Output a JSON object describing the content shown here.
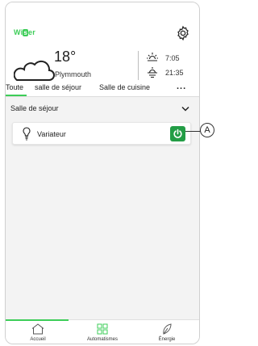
{
  "app": {
    "logo_text": "Wiser",
    "logo_part_a": "Wi",
    "logo_part_b": "s",
    "logo_part_c": "er"
  },
  "weather": {
    "temperature": "18°",
    "city": "Plymmouth",
    "sunrise": "7:05",
    "sunset": "21:35"
  },
  "tabs": [
    {
      "label": "Toute",
      "active": true
    },
    {
      "label": "salle de séjour",
      "active": false
    },
    {
      "label": "Salle de cuisine",
      "active": false
    }
  ],
  "more_label": "...",
  "section": {
    "title": "Salle de séjour"
  },
  "devices": [
    {
      "label": "Variateur",
      "power": "on"
    }
  ],
  "callout": {
    "label": "A"
  },
  "bottom_nav": [
    {
      "label": "Accueil",
      "active": true
    },
    {
      "label": "Automatismes",
      "active": false
    },
    {
      "label": "Énergie",
      "active": false
    }
  ],
  "colors": {
    "accent": "#3dcd58",
    "power_button": "#239d46"
  }
}
